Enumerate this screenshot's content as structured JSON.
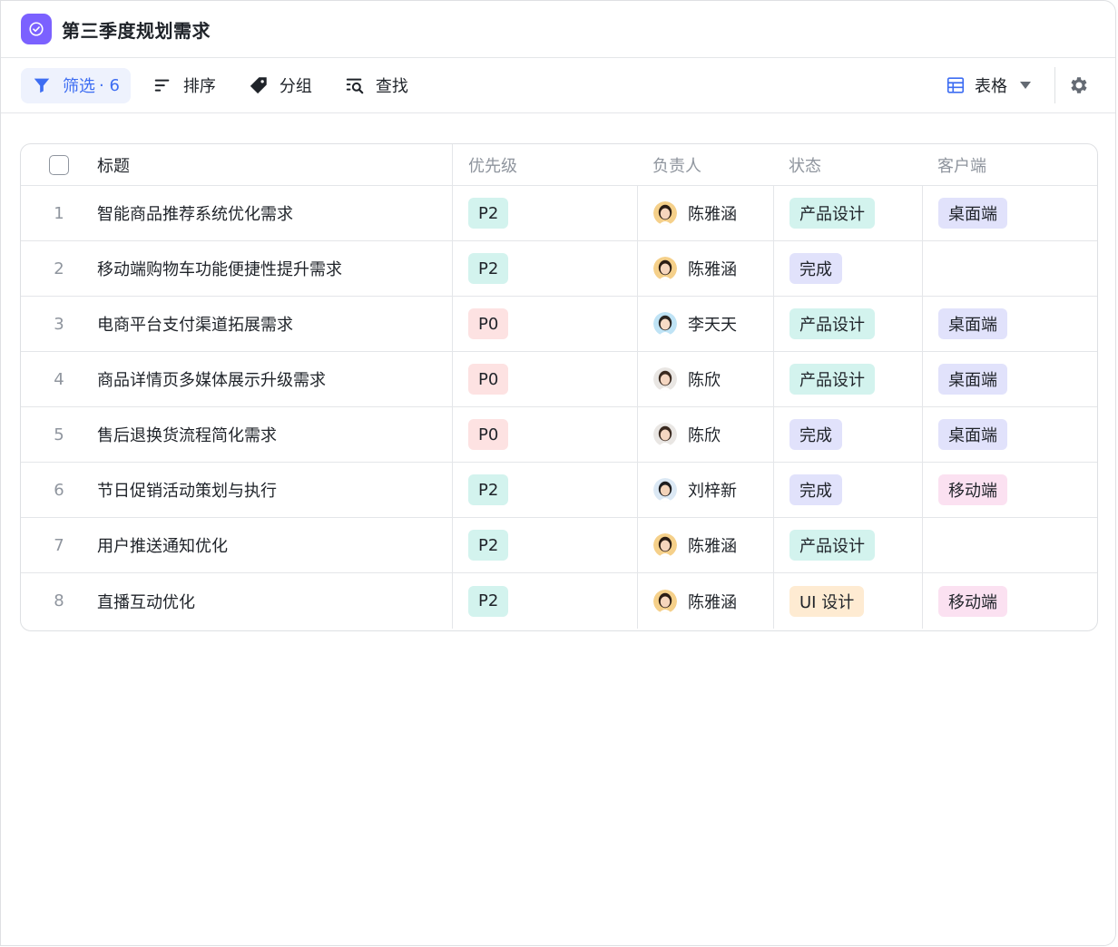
{
  "header": {
    "title": "第三季度规划需求",
    "icon": "check-circle-icon",
    "icon_color": "#7b61ff"
  },
  "toolbar": {
    "filter_label": "筛选",
    "filter_count": "· 6",
    "sort_label": "排序",
    "group_label": "分组",
    "find_label": "查找",
    "view_label": "表格"
  },
  "table": {
    "columns": [
      "标题",
      "优先级",
      "负责人",
      "状态",
      "客户端"
    ],
    "rows": [
      {
        "index": "1",
        "title": "智能商品推荐系统优化需求",
        "priority": "P2",
        "owner": "陈雅涵",
        "status": "产品设计",
        "client": "桌面端"
      },
      {
        "index": "2",
        "title": "移动端购物车功能便捷性提升需求",
        "priority": "P2",
        "owner": "陈雅涵",
        "status": "完成",
        "client": ""
      },
      {
        "index": "3",
        "title": "电商平台支付渠道拓展需求",
        "priority": "P0",
        "owner": "李天天",
        "status": "产品设计",
        "client": "桌面端"
      },
      {
        "index": "4",
        "title": "商品详情页多媒体展示升级需求",
        "priority": "P0",
        "owner": "陈欣",
        "status": "产品设计",
        "client": "桌面端"
      },
      {
        "index": "5",
        "title": "售后退换货流程简化需求",
        "priority": "P0",
        "owner": "陈欣",
        "status": "完成",
        "client": "桌面端"
      },
      {
        "index": "6",
        "title": "节日促销活动策划与执行",
        "priority": "P2",
        "owner": "刘梓新",
        "status": "完成",
        "client": "移动端"
      },
      {
        "index": "7",
        "title": "用户推送通知优化",
        "priority": "P2",
        "owner": "陈雅涵",
        "status": "产品设计",
        "client": ""
      },
      {
        "index": "8",
        "title": "直播互动优化",
        "priority": "P2",
        "owner": "陈雅涵",
        "status": "UI 设计",
        "client": "移动端"
      }
    ]
  },
  "colors": {
    "accent": "#3d6df2",
    "p2_tag": "#d3f3ee",
    "p0_tag": "#fde2e2",
    "status_design": "#d3f3ee",
    "status_done": "#e1e2fb",
    "status_ui": "#feebd2",
    "client_desktop": "#e1e2fb",
    "client_mobile": "#fbe1f1"
  }
}
